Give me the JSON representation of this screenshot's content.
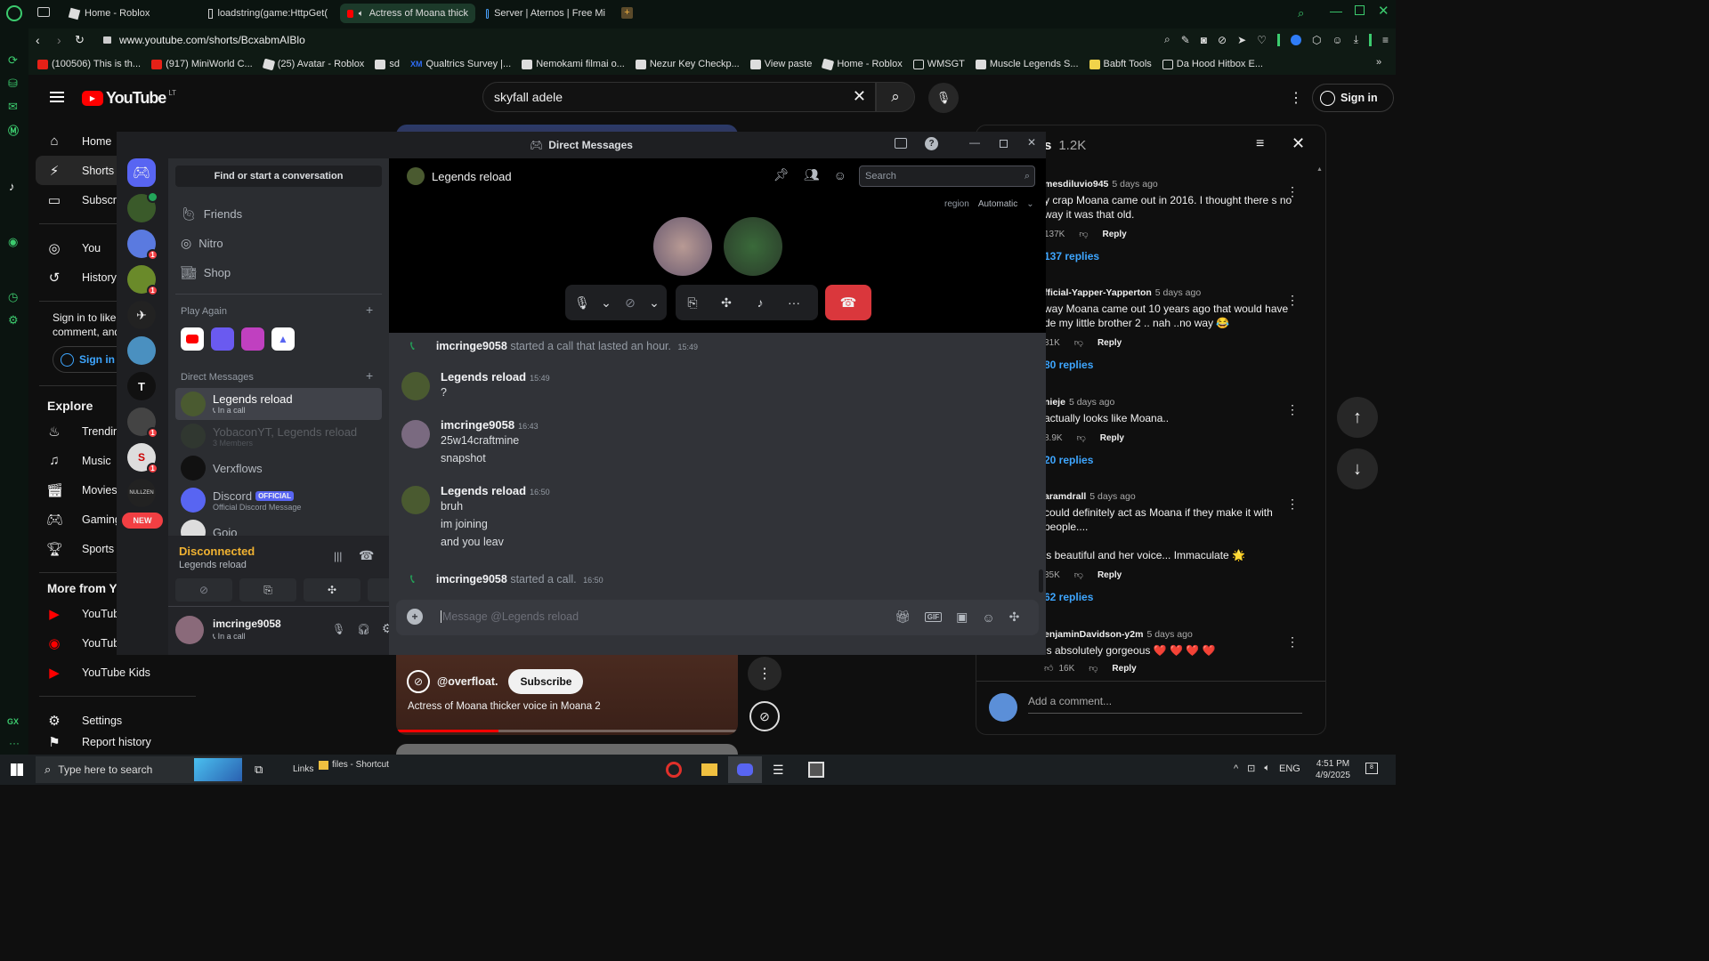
{
  "browser": {
    "tabs": [
      {
        "title": "Home - Roblox",
        "active": false
      },
      {
        "title": "loadstring(game:HttpGet(",
        "active": false
      },
      {
        "title": "Actress of Moana thick",
        "active": true
      },
      {
        "title": "Server | Aternos | Free Mi",
        "active": false
      }
    ],
    "url": "www.youtube.com/shorts/BcxabmAIBlo",
    "bookmarks": [
      {
        "label": "(100506) This is th...",
        "color": "#e62117"
      },
      {
        "label": "(917) MiniWorld C...",
        "color": "#e62117"
      },
      {
        "label": "(25) Avatar - Roblox",
        "color": "#dddddd"
      },
      {
        "label": "sd",
        "color": "#dddddd"
      },
      {
        "label": "Qualtrics Survey |...",
        "color": "#2f6df6"
      },
      {
        "label": "Nemokami filmai o...",
        "color": "#dddddd"
      },
      {
        "label": "Nezur Key Checkp...",
        "color": "#dddddd"
      },
      {
        "label": "View paste",
        "color": "#dddddd"
      },
      {
        "label": "Home - Roblox",
        "color": "#dddddd"
      },
      {
        "label": "WMSGT",
        "color": "#dddddd"
      },
      {
        "label": "Muscle Legends S...",
        "color": "#dddddd"
      },
      {
        "label": "Babft Tools",
        "color": "#f0d34a"
      },
      {
        "label": "Da Hood Hitbox E...",
        "color": "#dddddd"
      }
    ]
  },
  "youtube": {
    "logo": "YouTube",
    "region": "LT",
    "search_value": "skyfall adele",
    "sign_in": "Sign in",
    "nav": {
      "home": "Home",
      "shorts": "Shorts",
      "subscriptions": "Subscr",
      "you": "You",
      "history": "History",
      "signin_prompt_1": "Sign in to like",
      "signin_prompt_2": "comment, and",
      "signin_button": "Sign in",
      "explore": "Explore",
      "trending": "Trendin",
      "music": "Music",
      "movies": "Movies",
      "gaming": "Gaming",
      "sports": "Sports",
      "more_from": "More from Yo",
      "yt1": "YouTub",
      "yt2": "YouTub",
      "kids": "YouTube Kids",
      "settings": "Settings",
      "report": "Report history"
    },
    "short": {
      "channel": "@overfloat.",
      "subscribe": "Subscribe",
      "title": "Actress of Moana thicker voice in Moana 2",
      "progress": 0.3
    },
    "comments": {
      "header": "s",
      "count": "1.2K",
      "add_placeholder": "Add a comment...",
      "reply_label": "Reply",
      "items": [
        {
          "author": "mesdiluvio945",
          "time": "5 days ago",
          "text": "y crap Moana came out in 2016. I thought there s no way it was that old.",
          "likes": "137K",
          "replies": "137 replies"
        },
        {
          "author": "fficial-Yapper-Yapperton",
          "time": "5 days ago",
          "text": "way Moana came out 10 years ago that would have de my little brother 2 .. nah ..no way 😂",
          "likes": "31K",
          "replies": "80 replies"
        },
        {
          "author": "nieje",
          "time": "5 days ago",
          "text": "actually looks like Moana..",
          "likes": "8.9K",
          "replies": "20 replies"
        },
        {
          "author": "aramdrall",
          "time": "5 days ago",
          "text": "could definitely act as Moana if they make it with people....",
          "text2": "'s beautiful and her voice... Immaculate 🌟",
          "likes": "35K",
          "replies": "62 replies"
        },
        {
          "author": "enjaminDavidson-y2m",
          "time": "5 days ago",
          "text": "is absolutely gorgeous ❤️ ❤️ ❤️ ❤️",
          "likes": "16K",
          "replies": ""
        }
      ]
    }
  },
  "discord": {
    "window_title": "Direct Messages",
    "find_placeholder": "Find or start a conversation",
    "friends": "Friends",
    "nitro": "Nitro",
    "shop": "Shop",
    "play_again": "Play Again",
    "direct_messages": "Direct Messages",
    "new_badge": "NEW",
    "dms": [
      {
        "name": "Legends reload",
        "sub": "In a call",
        "active": true
      },
      {
        "name": "YobaconYT, Legends reload",
        "sub": "3 Members",
        "muted": true
      },
      {
        "name": "Verxflows",
        "sub": ""
      },
      {
        "name": "Discord",
        "badge": "OFFICIAL",
        "sub": "Official Discord Message"
      },
      {
        "name": "Gojo",
        "sub": ""
      }
    ],
    "voice_panel": {
      "status": "Disconnected",
      "channel": "Legends reload"
    },
    "user": {
      "name": "imcringe9058",
      "status": "In a call"
    },
    "chat": {
      "header": "Legends reload",
      "search_placeholder": "Search",
      "region_label": "region",
      "region_value": "Automatic",
      "input_placeholder": "Message @Legends reload",
      "messages": [
        {
          "type": "system",
          "author": "imcringe9058",
          "text": "started a call that lasted an hour.",
          "time": "15:49"
        },
        {
          "type": "msg",
          "author": "Legends reload",
          "time": "15:49",
          "lines": [
            "?"
          ]
        },
        {
          "type": "msg",
          "author": "imcringe9058",
          "time": "16:43",
          "lines": [
            "25w14craftmine",
            "snapshot"
          ]
        },
        {
          "type": "msg",
          "author": "Legends reload",
          "time": "16:50",
          "lines": [
            "bruh",
            "im joining",
            "and you leav"
          ]
        },
        {
          "type": "system",
          "author": "imcringe9058",
          "text": "started a call.",
          "time": "16:50"
        }
      ]
    }
  },
  "taskbar": {
    "search_placeholder": "Type here to search",
    "links": "Links",
    "files": "files - Shortcut",
    "lang": "ENG",
    "time": "4:51 PM",
    "date": "4/9/2025",
    "notifications": "8"
  },
  "colors": {
    "opera_bg": "#0b1410",
    "youtube_red": "#ff0000",
    "discord_blurple": "#5865f2",
    "discord_red": "#da373c",
    "link_blue": "#3ea6ff"
  }
}
